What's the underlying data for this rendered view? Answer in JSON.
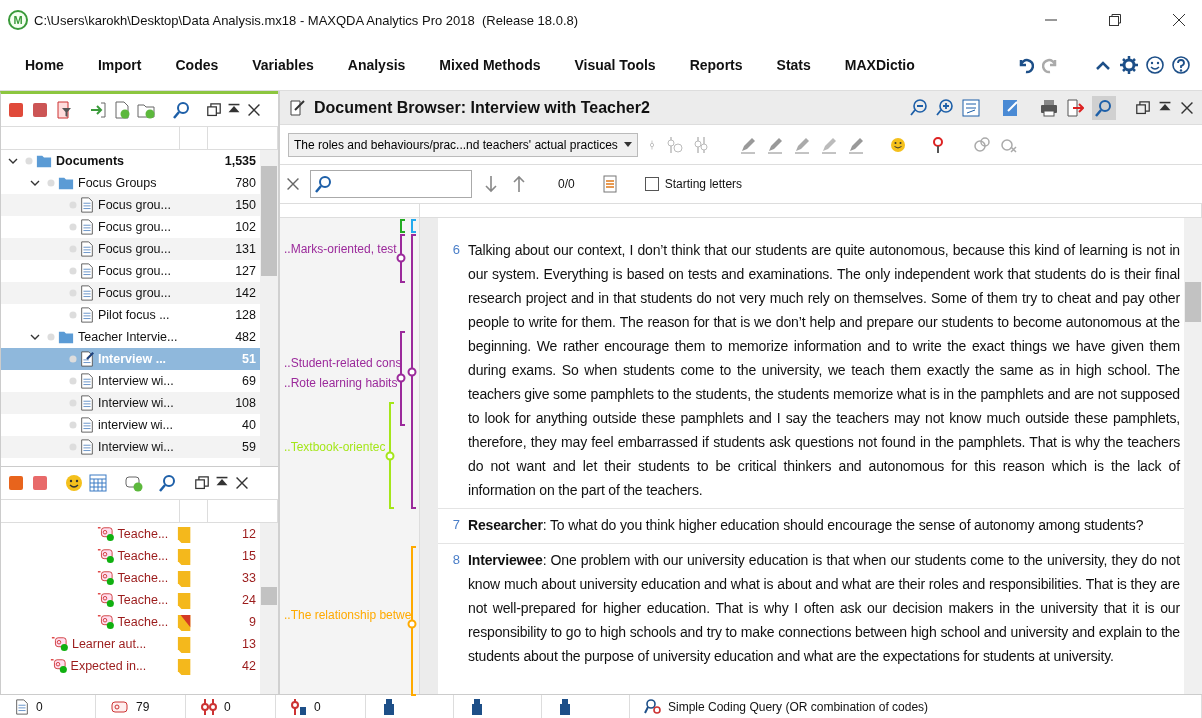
{
  "window": {
    "logo_letter": "M",
    "title": "C:\\Users\\karokh\\Desktop\\Data Analysis.mx18 - MAXQDA Analytics Pro 2018  (Release 18.0.8)"
  },
  "menu": [
    {
      "label": "Home"
    },
    {
      "label": "Import"
    },
    {
      "label": "Codes"
    },
    {
      "label": "Variables"
    },
    {
      "label": "Analysis"
    },
    {
      "label": "Mixed Methods"
    },
    {
      "label": "Visual Tools"
    },
    {
      "label": "Reports"
    },
    {
      "label": "Stats"
    },
    {
      "label": "MAXDictio"
    }
  ],
  "document_system": {
    "tree": [
      {
        "label": "Documents",
        "count": "1,535",
        "kind": "root",
        "expanded": true,
        "selected": false,
        "children": [
          {
            "label": "Focus Groups",
            "count": "780",
            "kind": "folder",
            "expanded": true,
            "selected": false,
            "children": [
              {
                "label": "Focus grou...",
                "count": "150",
                "kind": "doc",
                "selected": false
              },
              {
                "label": "Focus grou...",
                "count": "102",
                "kind": "doc",
                "selected": false
              },
              {
                "label": "Focus grou...",
                "count": "131",
                "kind": "doc",
                "selected": false
              },
              {
                "label": "Focus grou...",
                "count": "127",
                "kind": "doc",
                "selected": false
              },
              {
                "label": "Focus grou...",
                "count": "142",
                "kind": "doc",
                "selected": false
              },
              {
                "label": "Pilot focus ...",
                "count": "128",
                "kind": "doc",
                "selected": false
              }
            ]
          },
          {
            "label": "Teacher Intervie...",
            "count": "482",
            "kind": "folder",
            "expanded": true,
            "selected": false,
            "children": [
              {
                "label": "Interview ...",
                "count": "51",
                "kind": "doc",
                "selected": true
              },
              {
                "label": "Interview wi...",
                "count": "69",
                "kind": "doc",
                "selected": false
              },
              {
                "label": "Interview wi...",
                "count": "108",
                "kind": "doc",
                "selected": false
              },
              {
                "label": "interview wi...",
                "count": "40",
                "kind": "doc",
                "selected": false
              },
              {
                "label": "Interview wi...",
                "count": "59",
                "kind": "doc",
                "selected": false
              }
            ]
          }
        ]
      }
    ]
  },
  "code_system": {
    "rows": [
      {
        "label": "Teache...",
        "count": "12",
        "kind": "subcode",
        "memo": {
          "kind": "plain"
        }
      },
      {
        "label": "Teache...",
        "count": "15",
        "kind": "subcode",
        "memo": {
          "kind": "plain"
        }
      },
      {
        "label": "Teache...",
        "count": "33",
        "kind": "subcode",
        "memo": {
          "kind": "plain"
        }
      },
      {
        "label": "Teache...",
        "count": "24",
        "kind": "subcode",
        "memo": {
          "kind": "plain"
        }
      },
      {
        "label": "Teache...",
        "count": "9",
        "kind": "subcode",
        "memo": {
          "kind": "split"
        }
      },
      {
        "label": "Learner aut...",
        "count": "13",
        "kind": "code",
        "memo": {
          "kind": "plain"
        }
      },
      {
        "label": "Expected in...",
        "count": "42",
        "kind": "code",
        "memo": {
          "kind": "plain"
        }
      }
    ]
  },
  "document_browser": {
    "title": "Document Browser: Interview with Teacher2",
    "code_dropdown": "The roles and behaviours/prac...nd teachers' actual practices",
    "search": {
      "counter": "0/0",
      "starting_letters": {
        "label": "Starting letters",
        "checked": false
      }
    },
    "codings": [
      {
        "color": "#22aa22"
      },
      {
        "color": "#22aaee"
      },
      {
        "label": "..Marks-oriented, test",
        "color": "#9b2a9b"
      },
      {
        "color": "#9b2a9b"
      },
      {
        "label": "..Student-related cons",
        "color": "#9b2a9b"
      },
      {
        "label": "..Rote learning habits",
        "color": "#9b2a9b"
      },
      {
        "label": "..Textbook-orientec",
        "color": "#a4e619"
      },
      {
        "label": "..The relationship betwe",
        "color": "#ffaa00"
      }
    ],
    "paragraphs": [
      {
        "number": "6",
        "text": "Talking about our context, I don’t think that our students are quite autonomous, because this kind of learning is not in our system. Everything is based on tests and examinations. The only independent work that students do is their final research project and in that students do not very much rely on themselves. Some of them try to cheat and pay other people to write for them. The reason for that is we don’t help and prepare our students to become autonomous at the beginning. We rather encourage them to memorize information and to write the exact things we have given them during exams. So when students come to the university, we teach them exactly the same as in high school. The teachers give some pamphlets to the students, the students memorize what is in the pamphlets and are not supposed to look for anything outside these pamphlets and I say the teachers may not know much outside these pamphlets, therefore, they may feel embarrassed if students ask questions not found in the pamphlets. That is why the teachers do not want and let their students to be critical thinkers and autonomous for this reason which is the lack of information on the part of the teachers."
      },
      {
        "number": "7",
        "text": "**Researcher**: To what do you think higher education should encourage the sense of autonomy among students?"
      },
      {
        "number": "8",
        "text": "**Interviewee**: One problem with our university education is that when our students come to the university, they do not know much about university education and what is about and what are their roles and responsibilities. That is they are not well-prepared for higher education. That is why I often ask our decision makers in the university that it is our responsibility to go to high schools and try to make connections between high school and university and explain to the students about the purpose of university education and what are the expectations for students at university."
      }
    ]
  },
  "status_bar": [
    {
      "kind": "documents",
      "text": "0"
    },
    {
      "kind": "codes",
      "text": "79"
    },
    {
      "kind": "activated",
      "text": "0"
    },
    {
      "kind": "weighted",
      "text": "0"
    },
    {
      "kind": "icon"
    },
    {
      "kind": "icon"
    },
    {
      "kind": "icon"
    },
    {
      "kind": "query",
      "text": "Simple Coding Query (OR combination of codes)"
    }
  ]
}
